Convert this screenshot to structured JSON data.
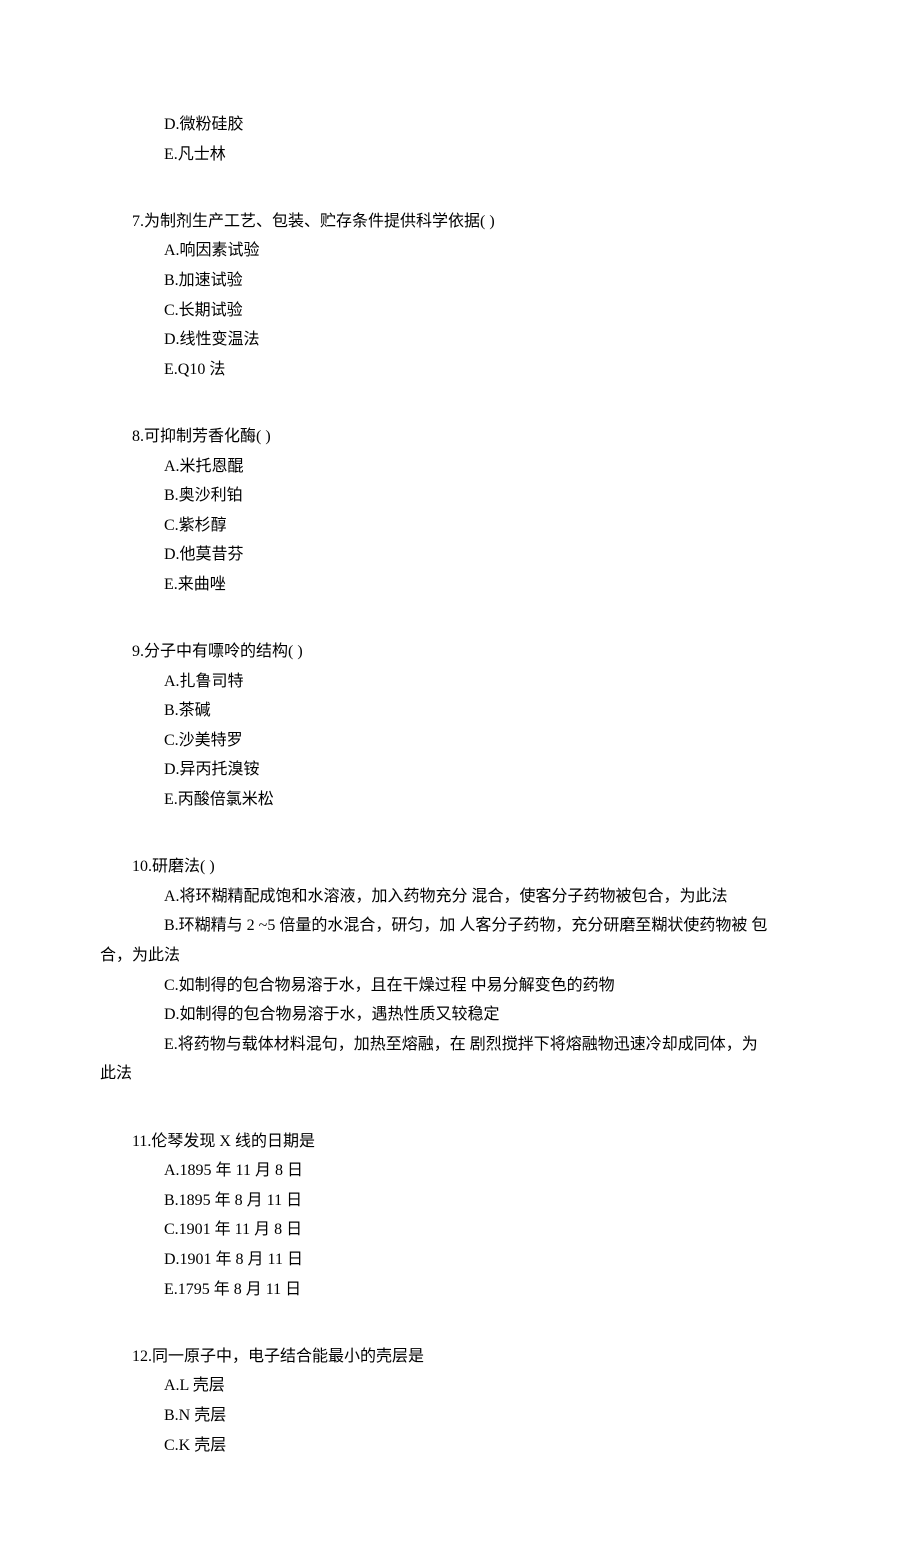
{
  "q6": {
    "d": "D.微粉硅胶",
    "e": "E.凡士林"
  },
  "q7": {
    "text": "7.为制剂生产工艺、包装、贮存条件提供科学依据( )",
    "a": "A.响因素试验",
    "b": "B.加速试验",
    "c": "C.长期试验",
    "d": "D.线性变温法",
    "e": "E.Q10 法"
  },
  "q8": {
    "text": "8.可抑制芳香化酶( )",
    "a": "A.米托恩醌",
    "b": "B.奥沙利铂",
    "c": "C.紫杉醇",
    "d": "D.他莫昔芬",
    "e": "E.来曲唑"
  },
  "q9": {
    "text": "9.分子中有嘌呤的结构( )",
    "a": "A.扎鲁司特",
    "b": "B.茶碱",
    "c": "C.沙美特罗",
    "d": "D.异丙托溴铵",
    "e": "E.丙酸倍氯米松"
  },
  "q10": {
    "text": "10.研磨法( )",
    "a": "A.将环糊精配成饱和水溶液，加入药物充分 混合，使客分子药物被包合，为此法",
    "b_line1": "B.环糊精与 2 ~5 倍量的水混合，研匀，加 人客分子药物，充分研磨至糊状使药物被 包",
    "b_line2": "合，为此法",
    "c": "C.如制得的包合物易溶于水，且在干燥过程 中易分解变色的药物",
    "d": "D.如制得的包合物易溶于水，遇热性质又较稳定",
    "e_line1": "E.将药物与载体材料混句，加热至熔融，在 剧烈搅拌下将熔融物迅速冷却成同体，为",
    "e_line2": "此法"
  },
  "q11": {
    "text": "11.伦琴发现 X 线的日期是",
    "a": "A.1895 年 11 月 8 日",
    "b": "B.1895 年 8 月 11 日",
    "c": "C.1901 年 11 月 8 日",
    "d": "D.1901 年 8 月 11 日",
    "e": "E.1795 年 8 月 11 日"
  },
  "q12": {
    "text": "12.同一原子中，电子结合能最小的壳层是",
    "a": "A.L 壳层",
    "b": "B.N 壳层",
    "c": "C.K 壳层"
  }
}
